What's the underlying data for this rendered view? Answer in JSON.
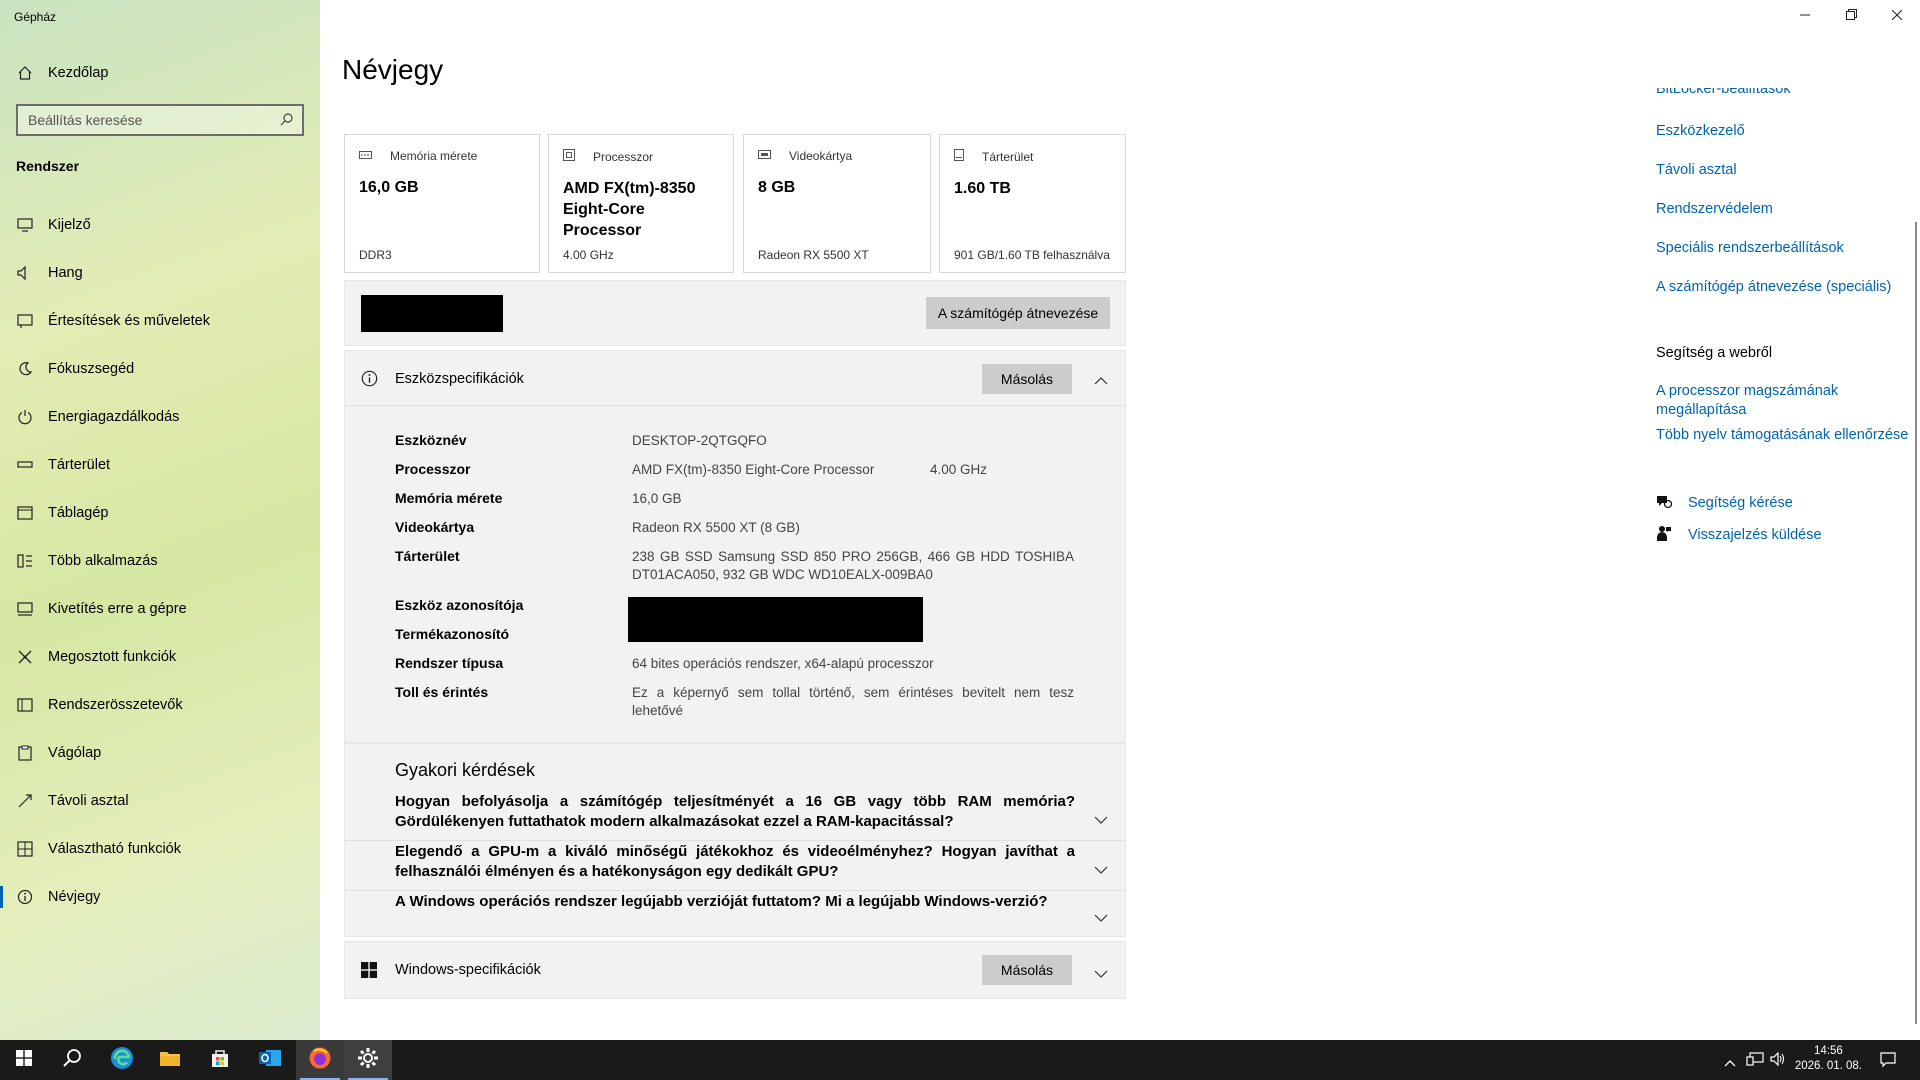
{
  "app_title": "Gépház",
  "sidebar": {
    "home_label": "Kezdőlap",
    "search_placeholder": "Beállítás keresése",
    "section_title": "Rendszer",
    "items": [
      {
        "label": "Kijelző",
        "icon": "monitor-icon"
      },
      {
        "label": "Hang",
        "icon": "speaker-icon"
      },
      {
        "label": "Értesítések és műveletek",
        "icon": "notification-icon"
      },
      {
        "label": "Fókuszsegéd",
        "icon": "moon-icon"
      },
      {
        "label": "Energiagazdálkodás",
        "icon": "power-icon"
      },
      {
        "label": "Tárterület",
        "icon": "storage-icon"
      },
      {
        "label": "Táblagép",
        "icon": "tablet-icon"
      },
      {
        "label": "Több alkalmazás",
        "icon": "multitask-icon"
      },
      {
        "label": "Kivetítés erre a gépre",
        "icon": "project-icon"
      },
      {
        "label": "Megosztott funkciók",
        "icon": "shared-icon"
      },
      {
        "label": "Rendszerösszetevők",
        "icon": "components-icon"
      },
      {
        "label": "Vágólap",
        "icon": "clipboard-icon"
      },
      {
        "label": "Távoli asztal",
        "icon": "remote-icon"
      },
      {
        "label": "Választható funkciók",
        "icon": "features-icon"
      },
      {
        "label": "Névjegy",
        "icon": "info-icon",
        "active": true
      }
    ]
  },
  "main": {
    "title": "Névjegy",
    "cards": [
      {
        "header": "Memória mérete",
        "value": "16,0 GB",
        "sub": "DDR3",
        "icon": "memory-icon"
      },
      {
        "header": "Processzor",
        "value": "AMD FX(tm)-8350 Eight-Core Processor",
        "sub": "4.00 GHz",
        "icon": "processor-icon"
      },
      {
        "header": "Videokártya",
        "value": "8 GB",
        "sub": "Radeon RX 5500 XT",
        "icon": "gpu-icon"
      },
      {
        "header": "Tárterület",
        "value": "1.60 TB",
        "sub": "901 GB/1.60 TB felhasználva",
        "icon": "drive-icon"
      }
    ],
    "rename_button": "A számítógép átnevezése",
    "device_specs": {
      "title": "Eszközspecifikációk",
      "copy_label": "Másolás",
      "rows": [
        {
          "label": "Eszköznév",
          "value": "DESKTOP-2QTGQFO",
          "extra": ""
        },
        {
          "label": "Processzor",
          "value": "AMD FX(tm)-8350 Eight-Core Processor",
          "extra": "4.00 GHz"
        },
        {
          "label": "Memória mérete",
          "value": "16,0 GB",
          "extra": ""
        },
        {
          "label": "Videokártya",
          "value": "Radeon RX 5500 XT (8 GB)",
          "extra": ""
        },
        {
          "label": "Tárterület",
          "value": "238 GB SSD Samsung SSD 850 PRO 256GB, 466 GB HDD TOSHIBA DT01ACA050, 932 GB WDC WD10EALX-009BA0",
          "extra": ""
        },
        {
          "label": "Eszköz azonosítója",
          "value": "",
          "extra": ""
        },
        {
          "label": "Termékazonosító",
          "value": "",
          "extra": ""
        },
        {
          "label": "Rendszer típusa",
          "value": "64 bites operációs rendszer, x64-alapú processzor",
          "extra": ""
        },
        {
          "label": "Toll és érintés",
          "value": "Ez a képernyő sem tollal történő, sem érintéses bevitelt nem tesz lehetővé",
          "extra": ""
        }
      ]
    },
    "faq": {
      "title": "Gyakori kérdések",
      "questions": [
        "Hogyan befolyásolja a számítógép teljesítményét a 16 GB vagy több RAM memória? Gördülékenyen futtathatok modern alkalmazásokat ezzel a RAM-kapacitással?",
        "Elegendő a GPU-m a kiváló minőségű játékokhoz és videoélményhez? Hogyan javíthat a felhasználói élményen és a hatékonyságon egy dedikált GPU?",
        "A Windows operációs rendszer legújabb verzióját futtatom? Mi a legújabb Windows-verzió?"
      ]
    },
    "windows_specs": {
      "title": "Windows-specifikációk",
      "copy_label": "Másolás"
    }
  },
  "right": {
    "cut_link": "BitLocker-beállítások",
    "links": [
      "Eszközkezelő",
      "Távoli asztal",
      "Rendszervédelem",
      "Speciális rendszerbeállítások",
      "A számítógép átnevezése (speciális)"
    ],
    "web_help_title": "Segítség a webről",
    "web_links": [
      "A processzor magszámának megállapítása",
      "Több nyelv támogatásának ellenőrzése"
    ],
    "help_label": "Segítség kérése",
    "feedback_label": "Visszajelzés küldése"
  },
  "taskbar": {
    "time": "14:56",
    "date": "2026. 01. 08."
  },
  "colors": {
    "accent": "#0063b1",
    "taskbar": "#1a1a1a",
    "button_grey": "#cccccc"
  }
}
